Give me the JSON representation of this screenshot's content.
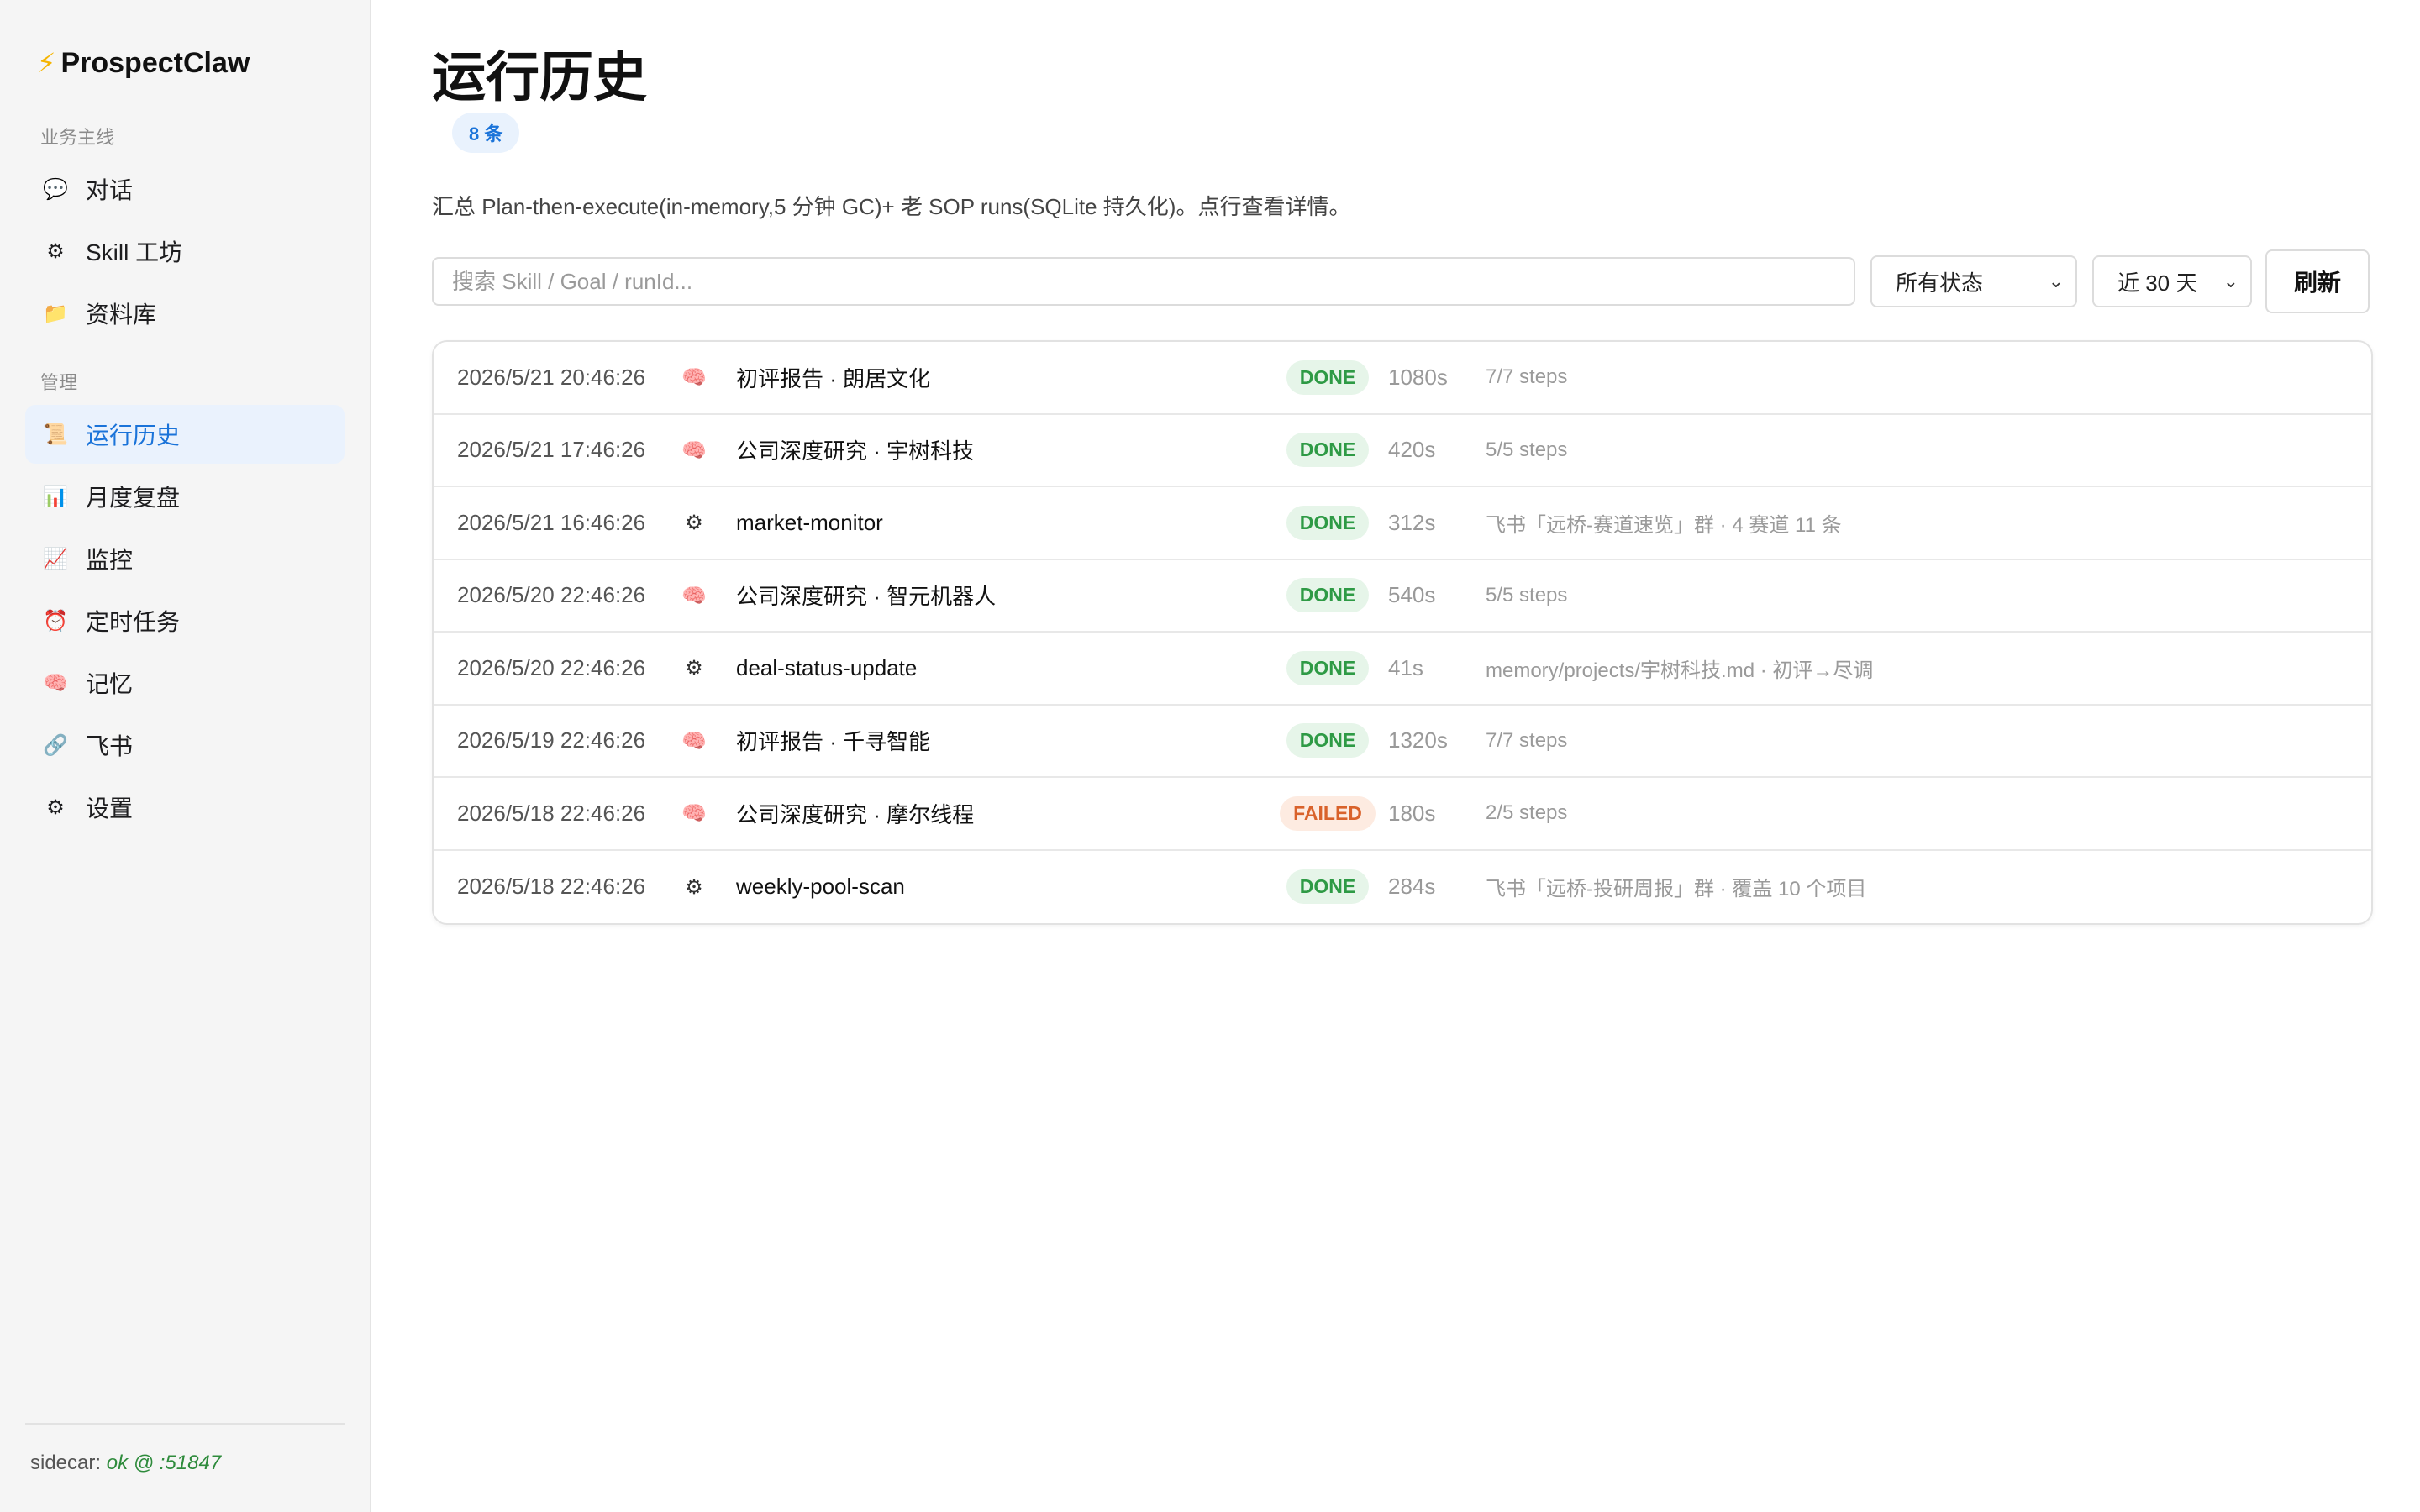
{
  "app": {
    "name": "ProspectClaw",
    "brand_icon": "⚡"
  },
  "sidebar": {
    "section_business": "业务主线",
    "section_admin": "管理",
    "business_items": [
      {
        "label": "对话",
        "icon": "💬",
        "icon_name": "chat-icon"
      },
      {
        "label": "Skill 工坊",
        "icon": "⚙",
        "icon_name": "gear-icon"
      },
      {
        "label": "资料库",
        "icon": "📁",
        "icon_name": "folder-icon"
      }
    ],
    "admin_items": [
      {
        "label": "运行历史",
        "icon": "📜",
        "icon_name": "scroll-icon",
        "active": true
      },
      {
        "label": "月度复盘",
        "icon": "📊",
        "icon_name": "bar-chart-icon"
      },
      {
        "label": "监控",
        "icon": "📈",
        "icon_name": "trend-chart-icon"
      },
      {
        "label": "定时任务",
        "icon": "⏰",
        "icon_name": "alarm-clock-icon"
      },
      {
        "label": "记忆",
        "icon": "🧠",
        "icon_name": "brain-icon"
      },
      {
        "label": "飞书",
        "icon": "🔗",
        "icon_name": "link-icon"
      },
      {
        "label": "设置",
        "icon": "⚙",
        "icon_name": "gear-icon"
      }
    ],
    "footer_label": "sidecar:",
    "footer_status": "ok @ :51847"
  },
  "main": {
    "title": "运行历史",
    "count_badge": "8 条",
    "description": "汇总 Plan-then-execute(in-memory,5 分钟 GC)+ 老 SOP runs(SQLite 持久化)。点行查看详情。",
    "search_placeholder": "搜索 Skill / Goal / runId...",
    "status_filter": "所有状态",
    "range_filter": "近 30 天",
    "refresh_label": "刷新"
  },
  "colors": {
    "accent": "#1a73d9",
    "done_bg": "#e6f5e9",
    "done_text": "#2e9a45",
    "failed_bg": "#fdebe1",
    "failed_text": "#d9622b"
  },
  "runs": [
    {
      "time": "2026/5/21 20:46:26",
      "icon": "🧠",
      "icon_name": "brain-icon",
      "name": "初评报告 · 朗居文化",
      "status": "DONE",
      "duration": "1080s",
      "note": "7/7 steps"
    },
    {
      "time": "2026/5/21 17:46:26",
      "icon": "🧠",
      "icon_name": "brain-icon",
      "name": "公司深度研究 · 宇树科技",
      "status": "DONE",
      "duration": "420s",
      "note": "5/5 steps"
    },
    {
      "time": "2026/5/21 16:46:26",
      "icon": "⚙",
      "icon_name": "gear-icon",
      "name": "market-monitor",
      "status": "DONE",
      "duration": "312s",
      "note": "飞书「远桥-赛道速览」群 · 4 赛道 11 条"
    },
    {
      "time": "2026/5/20 22:46:26",
      "icon": "🧠",
      "icon_name": "brain-icon",
      "name": "公司深度研究 · 智元机器人",
      "status": "DONE",
      "duration": "540s",
      "note": "5/5 steps"
    },
    {
      "time": "2026/5/20 22:46:26",
      "icon": "⚙",
      "icon_name": "gear-icon",
      "name": "deal-status-update",
      "status": "DONE",
      "duration": "41s",
      "note": "memory/projects/宇树科技.md · 初评→尽调"
    },
    {
      "time": "2026/5/19 22:46:26",
      "icon": "🧠",
      "icon_name": "brain-icon",
      "name": "初评报告 · 千寻智能",
      "status": "DONE",
      "duration": "1320s",
      "note": "7/7 steps"
    },
    {
      "time": "2026/5/18 22:46:26",
      "icon": "🧠",
      "icon_name": "brain-icon",
      "name": "公司深度研究 · 摩尔线程",
      "status": "FAILED",
      "duration": "180s",
      "note": "2/5 steps"
    },
    {
      "time": "2026/5/18 22:46:26",
      "icon": "⚙",
      "icon_name": "gear-icon",
      "name": "weekly-pool-scan",
      "status": "DONE",
      "duration": "284s",
      "note": "飞书「远桥-投研周报」群 · 覆盖 10 个项目"
    }
  ]
}
